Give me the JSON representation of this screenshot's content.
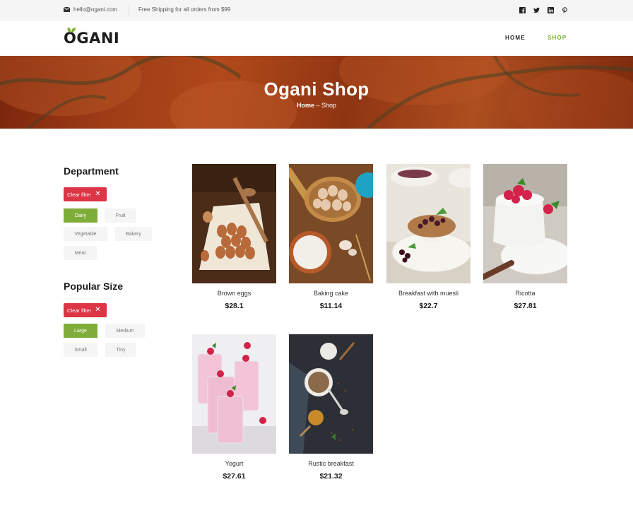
{
  "topbar": {
    "email": "hello@ogani.com",
    "shipping": "Free Shipping for all orders from $99",
    "social": [
      "facebook-icon",
      "twitter-icon",
      "linkedin-icon",
      "pinterest-icon"
    ]
  },
  "header": {
    "logo": "OGANI",
    "nav": [
      {
        "label": "HOME",
        "active": false
      },
      {
        "label": "SHOP",
        "active": true
      }
    ]
  },
  "hero": {
    "title": "Ogani Shop",
    "breadcrumb_home": "Home",
    "breadcrumb_sep": " – ",
    "breadcrumb_current": "Shop"
  },
  "sidebar": {
    "department": {
      "title": "Department",
      "clear_label": "Clear filter",
      "chips": [
        "Dairy",
        "Fruit",
        "Vegetable",
        "Bakery",
        "Meat"
      ],
      "active": "Dairy"
    },
    "size": {
      "title": "Popular Size",
      "clear_label": "Clear filter",
      "chips": [
        "Large",
        "Medium",
        "Small",
        "Tiny"
      ],
      "active": "Large"
    }
  },
  "products": [
    {
      "name": "Brown eggs",
      "price": "$28.1"
    },
    {
      "name": "Baking cake",
      "price": "$11.14"
    },
    {
      "name": "Breakfast with muesli",
      "price": "$22.7"
    },
    {
      "name": "Ricotta",
      "price": "$27.81"
    },
    {
      "name": "Yogurt",
      "price": "$27.61"
    },
    {
      "name": "Rustic breakfast",
      "price": "$21.32"
    }
  ],
  "colors": {
    "accent": "#7fad39",
    "danger": "#dc3545",
    "chip_bg": "#f5f5f5"
  }
}
